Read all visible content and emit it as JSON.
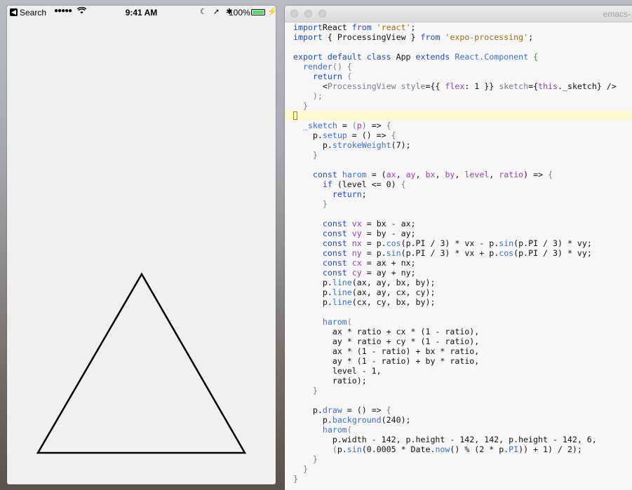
{
  "phone": {
    "status_bar": {
      "back_label": "Search",
      "signal": "●●●●●",
      "wifi_icon": "wifi-icon",
      "time": "9:41 AM",
      "icons": "☾ ➚ ✱",
      "battery_percent": "100%",
      "battery_level": 1.0,
      "bolt": "⚡"
    },
    "canvas": {
      "background": "#f0f0f0",
      "stroke_color": "#000000"
    }
  },
  "emacs": {
    "title": "emacs-",
    "code_lines": [
      [
        [
          "kw",
          "import"
        ],
        [
          "",
          "React "
        ],
        [
          "kw",
          "from"
        ],
        [
          "str",
          " 'react'"
        ],
        [
          "",
          ";"
        ]
      ],
      [
        [
          "kw",
          "import"
        ],
        [
          "",
          " { ProcessingView } "
        ],
        [
          "kw",
          "from"
        ],
        [
          "str",
          " 'expo-processing'"
        ],
        [
          "",
          ";"
        ]
      ],
      [],
      [
        [
          "kw",
          "export default class"
        ],
        [
          "",
          " App "
        ],
        [
          "kw",
          "extends"
        ],
        [
          "fn",
          " React.Component"
        ],
        [
          "",
          " "
        ],
        [
          "br1",
          "{"
        ]
      ],
      [
        [
          "",
          "  "
        ],
        [
          "fn",
          "render"
        ],
        [
          "pl",
          "() {"
        ]
      ],
      [
        [
          "",
          "    "
        ],
        [
          "kw",
          "return"
        ],
        [
          "pl",
          " ("
        ]
      ],
      [
        [
          "",
          "      <"
        ],
        [
          "pl",
          "ProcessingView"
        ],
        [
          "",
          " "
        ],
        [
          "pl",
          "style"
        ],
        [
          "",
          "={{ "
        ],
        [
          "vr",
          "flex"
        ],
        [
          "",
          ": 1 }} "
        ],
        [
          "pl",
          "sketch"
        ],
        [
          "",
          "={"
        ],
        [
          "th",
          "this"
        ],
        [
          "",
          "._sketch} />"
        ]
      ],
      [
        [
          "",
          "    "
        ],
        [
          "pl",
          ");"
        ]
      ],
      [
        [
          "",
          "  "
        ],
        [
          "pl",
          "}"
        ]
      ],
      [
        "CURSOR"
      ],
      [
        [
          "",
          "  "
        ],
        [
          "fn",
          "_sketch"
        ],
        [
          "",
          " = "
        ],
        [
          "pl",
          "("
        ],
        [
          "vr",
          "p"
        ],
        [
          "pl",
          ")"
        ],
        [
          "",
          " => "
        ],
        [
          "pl",
          "{"
        ]
      ],
      [
        [
          "",
          "    p."
        ],
        [
          "fn",
          "setup"
        ],
        [
          "",
          " = () => "
        ],
        [
          "pl",
          "{"
        ]
      ],
      [
        [
          "",
          "      p."
        ],
        [
          "fn",
          "strokeWeight"
        ],
        [
          "",
          "(7);"
        ]
      ],
      [
        [
          "",
          "    "
        ],
        [
          "pl",
          "}"
        ]
      ],
      [],
      [
        [
          "",
          "    "
        ],
        [
          "kw",
          "const"
        ],
        [
          "",
          " "
        ],
        [
          "fn",
          "harom"
        ],
        [
          "",
          " = ("
        ],
        [
          "vr",
          "ax"
        ],
        [
          "",
          ", "
        ],
        [
          "vr",
          "ay"
        ],
        [
          "",
          ", "
        ],
        [
          "vr",
          "bx"
        ],
        [
          "",
          ", "
        ],
        [
          "vr",
          "by"
        ],
        [
          "",
          ", "
        ],
        [
          "vr",
          "level"
        ],
        [
          "",
          ", "
        ],
        [
          "vr",
          "ratio"
        ],
        [
          "",
          ") => "
        ],
        [
          "pl",
          "{"
        ]
      ],
      [
        [
          "",
          "      "
        ],
        [
          "kw",
          "if"
        ],
        [
          "",
          " (level <= 0) "
        ],
        [
          "pl",
          "{"
        ]
      ],
      [
        [
          "",
          "        "
        ],
        [
          "kw",
          "return"
        ],
        [
          "",
          ";"
        ]
      ],
      [
        [
          "",
          "      "
        ],
        [
          "pl",
          "}"
        ]
      ],
      [],
      [
        [
          "",
          "      "
        ],
        [
          "kw",
          "const"
        ],
        [
          "",
          " "
        ],
        [
          "vr",
          "vx"
        ],
        [
          "",
          " = bx - ax;"
        ]
      ],
      [
        [
          "",
          "      "
        ],
        [
          "kw",
          "const"
        ],
        [
          "",
          " "
        ],
        [
          "vr",
          "vy"
        ],
        [
          "",
          " = by - ay;"
        ]
      ],
      [
        [
          "",
          "      "
        ],
        [
          "kw",
          "const"
        ],
        [
          "",
          " "
        ],
        [
          "vr",
          "nx"
        ],
        [
          "",
          " = p."
        ],
        [
          "fn",
          "cos"
        ],
        [
          "",
          "(p.PI / 3) * vx - p."
        ],
        [
          "fn",
          "sin"
        ],
        [
          "",
          "(p.PI / 3) * vy;"
        ]
      ],
      [
        [
          "",
          "      "
        ],
        [
          "kw",
          "const"
        ],
        [
          "",
          " "
        ],
        [
          "vr",
          "ny"
        ],
        [
          "",
          " = p."
        ],
        [
          "fn",
          "sin"
        ],
        [
          "",
          "(p.PI / 3) * vx + p."
        ],
        [
          "fn",
          "cos"
        ],
        [
          "",
          "(p.PI / 3) * vy;"
        ]
      ],
      [
        [
          "",
          "      "
        ],
        [
          "kw",
          "const"
        ],
        [
          "",
          " "
        ],
        [
          "vr",
          "cx"
        ],
        [
          "",
          " = ax + nx;"
        ]
      ],
      [
        [
          "",
          "      "
        ],
        [
          "kw",
          "const"
        ],
        [
          "",
          " "
        ],
        [
          "vr",
          "cy"
        ],
        [
          "",
          " = ay + ny;"
        ]
      ],
      [
        [
          "",
          "      p."
        ],
        [
          "fn",
          "line"
        ],
        [
          "",
          "(ax, ay, bx, by);"
        ]
      ],
      [
        [
          "",
          "      p."
        ],
        [
          "fn",
          "line"
        ],
        [
          "",
          "(ax, ay, cx, cy);"
        ]
      ],
      [
        [
          "",
          "      p."
        ],
        [
          "fn",
          "line"
        ],
        [
          "",
          "(cx, cy, bx, by);"
        ]
      ],
      [],
      [
        [
          "",
          "      "
        ],
        [
          "fn",
          "harom"
        ],
        [
          "pl",
          "("
        ]
      ],
      [
        [
          "",
          "        ax * ratio + cx * (1 - ratio),"
        ]
      ],
      [
        [
          "",
          "        ay * ratio + cy * (1 - ratio),"
        ]
      ],
      [
        [
          "",
          "        ax * (1 - ratio) + bx * ratio,"
        ]
      ],
      [
        [
          "",
          "        ay * (1 - ratio) + by * ratio,"
        ]
      ],
      [
        [
          "",
          "        level - 1,"
        ]
      ],
      [
        [
          "",
          "        ratio);"
        ]
      ],
      [
        [
          "",
          "    "
        ],
        [
          "pl",
          "}"
        ]
      ],
      [],
      [
        [
          "",
          "    p."
        ],
        [
          "fn",
          "draw"
        ],
        [
          "",
          " = () => "
        ],
        [
          "pl",
          "{"
        ]
      ],
      [
        [
          "",
          "      p."
        ],
        [
          "fn",
          "background"
        ],
        [
          "",
          "(240);"
        ]
      ],
      [
        [
          "",
          "      "
        ],
        [
          "fn",
          "harom"
        ],
        [
          "pl",
          "("
        ]
      ],
      [
        [
          "",
          "        p.width - 142, p.height - 142, 142, p.height - 142, 6,"
        ]
      ],
      [
        [
          "",
          "        "
        ],
        [
          "pl",
          "("
        ],
        [
          "",
          "p."
        ],
        [
          "fn",
          "sin"
        ],
        [
          "",
          "(0.0005 * Date."
        ],
        [
          "fn",
          "now"
        ],
        [
          "",
          "() % (2 * p."
        ],
        [
          "fn",
          "PI"
        ],
        [
          "",
          ")) + 1) / 2);"
        ]
      ],
      [
        [
          "",
          "    "
        ],
        [
          "pl",
          "}"
        ]
      ],
      [
        [
          "",
          "  "
        ],
        [
          "pl",
          "}"
        ]
      ],
      [
        [
          "br1",
          "}"
        ]
      ]
    ]
  }
}
